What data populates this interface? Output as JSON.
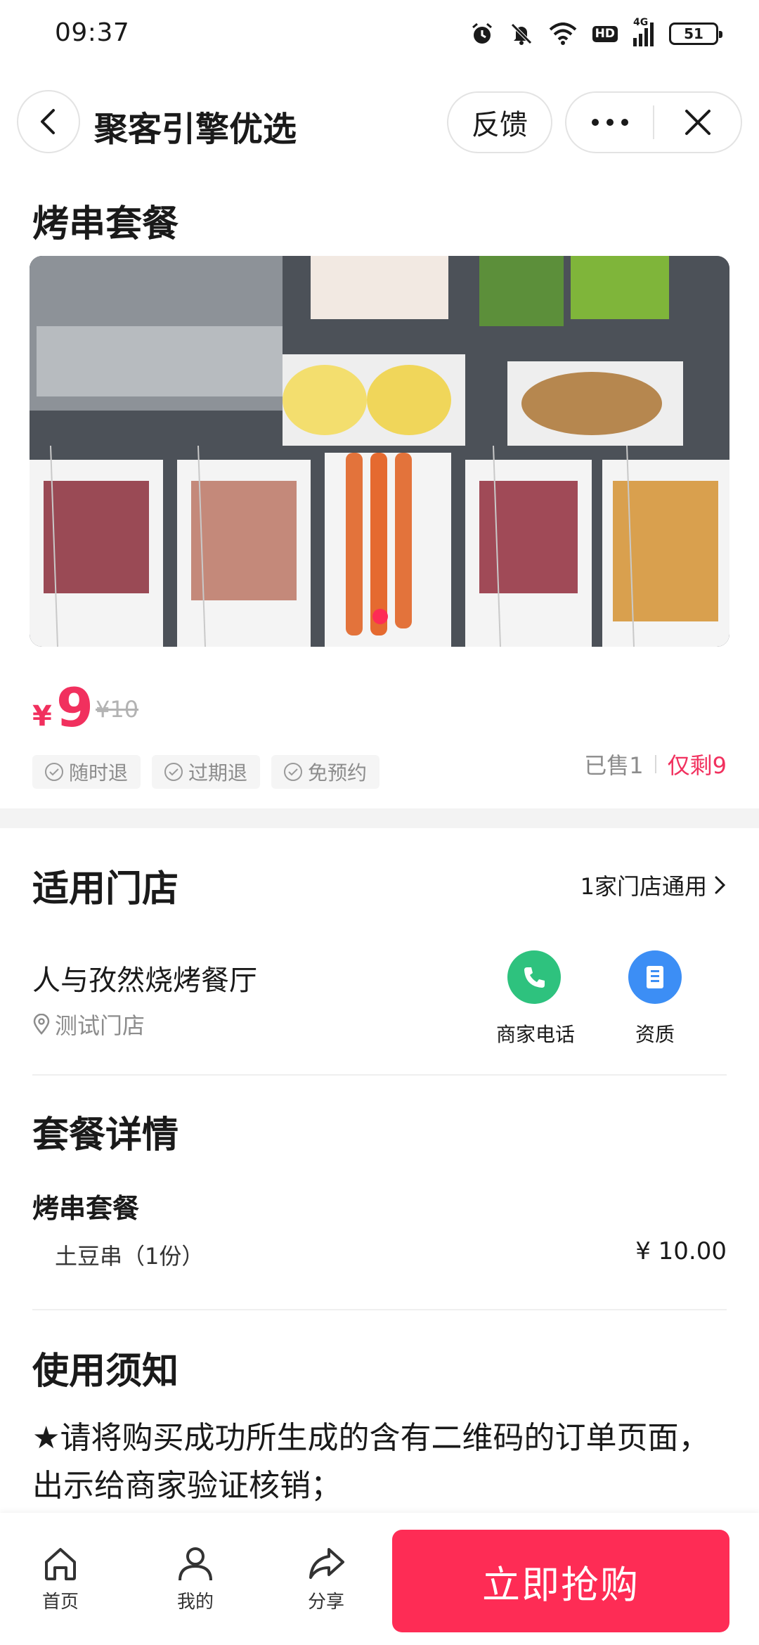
{
  "status_bar": {
    "time": "09:37",
    "network_badge": "HD",
    "signal_label": "4G",
    "battery": "51",
    "icons": [
      "alarm-icon",
      "bell-mute-icon",
      "wifi-icon",
      "hd-icon",
      "signal-icon",
      "battery-icon"
    ]
  },
  "nav": {
    "title": "聚客引擎优选",
    "feedback_label": "反馈",
    "more_icon": "more-dots-icon",
    "close_icon": "close-icon",
    "back_icon": "chevron-left-icon"
  },
  "product": {
    "title": "烤串套餐",
    "currency": "¥",
    "price": "9",
    "original_price": "¥10",
    "tags": [
      "随时退",
      "过期退",
      "免预约"
    ],
    "sold": "已售1",
    "remaining": "仅剩9"
  },
  "stores": {
    "section_title": "适用门店",
    "count_label": "1家门店通用",
    "store_name": "人与孜然烧烤餐厅",
    "store_address": "测试门店",
    "phone_label": "商家电话",
    "license_label": "资质"
  },
  "package": {
    "section_title": "套餐详情",
    "subtitle": "烤串套餐",
    "item_name": "土豆串（1份）",
    "item_price": "¥ 10.00"
  },
  "notice": {
    "section_title": "使用须知",
    "text": "★请将购买成功所生成的含有二维码的订单页面，出示给商家验证核销；"
  },
  "bottom_bar": {
    "home_label": "首页",
    "mine_label": "我的",
    "share_label": "分享",
    "buy_label": "立即抢购"
  },
  "colors": {
    "accent": "#fe2c55",
    "price": "#f1305e",
    "phone_green": "#2ec27e",
    "license_blue": "#3c8ef5"
  }
}
